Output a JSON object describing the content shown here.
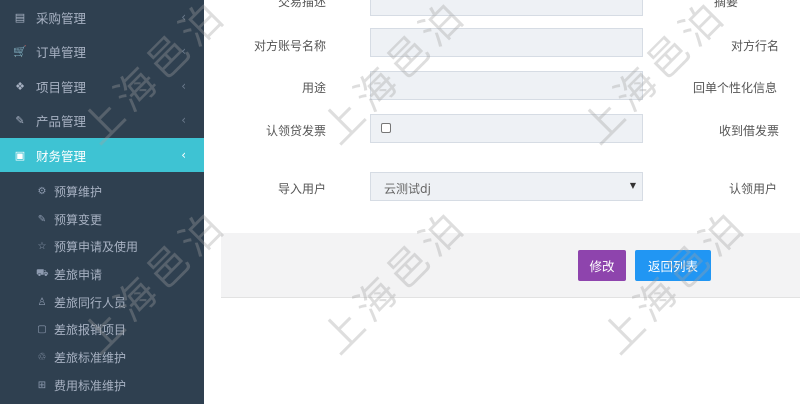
{
  "sidebar": {
    "menu": [
      {
        "label": "采购管理",
        "icon": "inbox-icon",
        "glyph": "▤",
        "chev": "‹"
      },
      {
        "label": "订单管理",
        "icon": "cart-icon",
        "glyph": "🛒",
        "chev": "‹"
      },
      {
        "label": "项目管理",
        "icon": "cubes-icon",
        "glyph": "❖",
        "chev": "‹"
      },
      {
        "label": "产品管理",
        "icon": "edit-icon",
        "glyph": "✎",
        "chev": "‹"
      },
      {
        "label": "财务管理",
        "icon": "money-icon",
        "glyph": "▣",
        "chev": "‹"
      }
    ],
    "submenu": [
      {
        "label": "预算维护",
        "icon": "gear-icon",
        "glyph": "⚙"
      },
      {
        "label": "预算变更",
        "icon": "edit-icon",
        "glyph": "✎"
      },
      {
        "label": "预算申请及使用",
        "icon": "star-icon",
        "glyph": "☆"
      },
      {
        "label": "差旅申请",
        "icon": "car-icon",
        "glyph": "⛟"
      },
      {
        "label": "差旅同行人员",
        "icon": "users-icon",
        "glyph": "♙"
      },
      {
        "label": "差旅报销项目",
        "icon": "square-icon",
        "glyph": "▢"
      },
      {
        "label": "差旅标准维护",
        "icon": "recycle-icon",
        "glyph": "♲"
      },
      {
        "label": "费用标准维护",
        "icon": "plus-square-icon",
        "glyph": "⊞"
      }
    ]
  },
  "form": {
    "row0": {
      "label": "交易描述",
      "right_label": "摘要"
    },
    "row1": {
      "label": "对方账号名称",
      "right_label": "对方行名"
    },
    "row2": {
      "label": "用途",
      "right_label": "回单个性化信息"
    },
    "row3": {
      "label": "认领贷发票",
      "right_label": "收到借发票"
    },
    "row4": {
      "label": "导入用户",
      "select_value": "云测试dj",
      "right_label": "认领用户"
    }
  },
  "buttons": {
    "edit": "修改",
    "back": "返回列表"
  },
  "watermark": "上海邑泊",
  "colors": {
    "sidebar_bg": "#2f4050",
    "active": "#3ec3d3",
    "edit_btn": "#8e44ad",
    "back_btn": "#2196f3"
  }
}
